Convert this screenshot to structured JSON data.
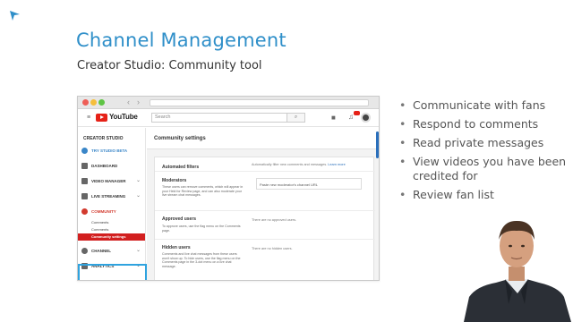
{
  "slide": {
    "title": "Channel Management",
    "subtitle": "Creator Studio: Community tool"
  },
  "browser": {
    "search_placeholder": "Search",
    "brand_word": "YouTube",
    "page_heading": "Community settings"
  },
  "sidebar": {
    "title": "CREATOR STUDIO",
    "items": [
      {
        "label": "TRY STUDIO BETA"
      },
      {
        "label": "DASHBOARD"
      },
      {
        "label": "VIDEO MANAGER"
      },
      {
        "label": "LIVE STREAMING"
      },
      {
        "label": "COMMUNITY"
      },
      {
        "label": "CHANNEL"
      },
      {
        "label": "ANALYTICS"
      }
    ],
    "sub_items": [
      {
        "label": "Comments"
      },
      {
        "label": "Comments"
      },
      {
        "label": "Community settings"
      }
    ]
  },
  "settings": {
    "automated": {
      "title": "Automated filters",
      "right": "Automatically filter new comments and messages.",
      "learn_more": "Learn more"
    },
    "moderators": {
      "title": "Moderators",
      "desc": "These users can remove comments, which will appear in your Held for Review page, and can also moderate your live stream chat messages.",
      "input": "Paste new moderator's channel URL"
    },
    "approved": {
      "title": "Approved users",
      "desc": "To approve users, use the flag menu on the Comments page.",
      "right": "There are no approved users."
    },
    "hidden": {
      "title": "Hidden users",
      "desc": "Comments and live chat messages from these users won't show up. To hide users, use the flag menu on the Comments page in the 3-dot menu on a live chat message.",
      "right": "There are no hidden users."
    }
  },
  "bullets": [
    "Communicate with fans",
    "Respond to comments",
    "Read private messages",
    "View videos you have been credited for",
    "Review fan list"
  ],
  "colors": {
    "title_blue": "#2f8fc9",
    "highlight_blue": "#2fa3df",
    "youtube_red": "#e62117"
  }
}
